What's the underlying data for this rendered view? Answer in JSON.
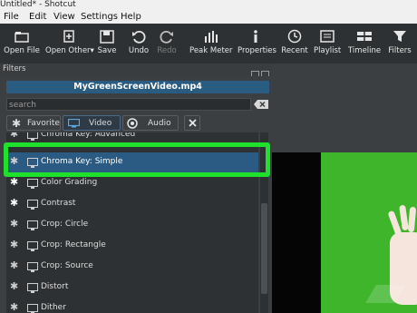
{
  "window": {
    "title": "Untitled* - Shotcut"
  },
  "menu": [
    "File",
    "Edit",
    "View",
    "Settings",
    "Help"
  ],
  "toolbar": [
    {
      "label": "Open File",
      "icon": "folder-icon",
      "enabled": true
    },
    {
      "label": "Open Other",
      "icon": "open-other-icon",
      "enabled": true,
      "has_dropdown": true
    },
    {
      "label": "Save",
      "icon": "save-icon",
      "enabled": true
    },
    {
      "label": "Undo",
      "icon": "undo-icon",
      "enabled": true
    },
    {
      "label": "Redo",
      "icon": "redo-icon",
      "enabled": false
    },
    {
      "label": "Peak Meter",
      "icon": "peak-meter-icon",
      "enabled": true
    },
    {
      "label": "Properties",
      "icon": "info-icon",
      "enabled": true
    },
    {
      "label": "Recent",
      "icon": "clock-icon",
      "enabled": true
    },
    {
      "label": "Playlist",
      "icon": "playlist-icon",
      "enabled": true
    },
    {
      "label": "Timeline",
      "icon": "timeline-icon",
      "enabled": true
    },
    {
      "label": "Filters",
      "icon": "funnel-icon",
      "enabled": true
    }
  ],
  "filters_panel": {
    "title": "Filters",
    "clip_name": "MyGreenScreenVideo.mp4",
    "search_placeholder": "search",
    "tabs": [
      {
        "label": "Favorite",
        "icon": "star-icon",
        "active": false
      },
      {
        "label": "Video",
        "icon": "monitor-icon",
        "active": true
      },
      {
        "label": "Audio",
        "icon": "speaker-icon",
        "active": false
      }
    ],
    "filters": [
      {
        "name": "Chroma Key: Advanced",
        "favorite": false,
        "selected": false
      },
      {
        "name": "Chroma Key: Simple",
        "favorite": false,
        "selected": true
      },
      {
        "name": "Color Grading",
        "favorite": true,
        "selected": false
      },
      {
        "name": "Contrast",
        "favorite": true,
        "selected": false
      },
      {
        "name": "Crop: Circle",
        "favorite": false,
        "selected": false
      },
      {
        "name": "Crop: Rectangle",
        "favorite": false,
        "selected": false
      },
      {
        "name": "Crop: Source",
        "favorite": false,
        "selected": false
      },
      {
        "name": "Distort",
        "favorite": false,
        "selected": false
      },
      {
        "name": "Dither",
        "favorite": false,
        "selected": false
      }
    ]
  },
  "colors": {
    "selection": "#2b5b82",
    "highlight_box": "#1fe02a",
    "green_screen": "#3eb52b"
  }
}
